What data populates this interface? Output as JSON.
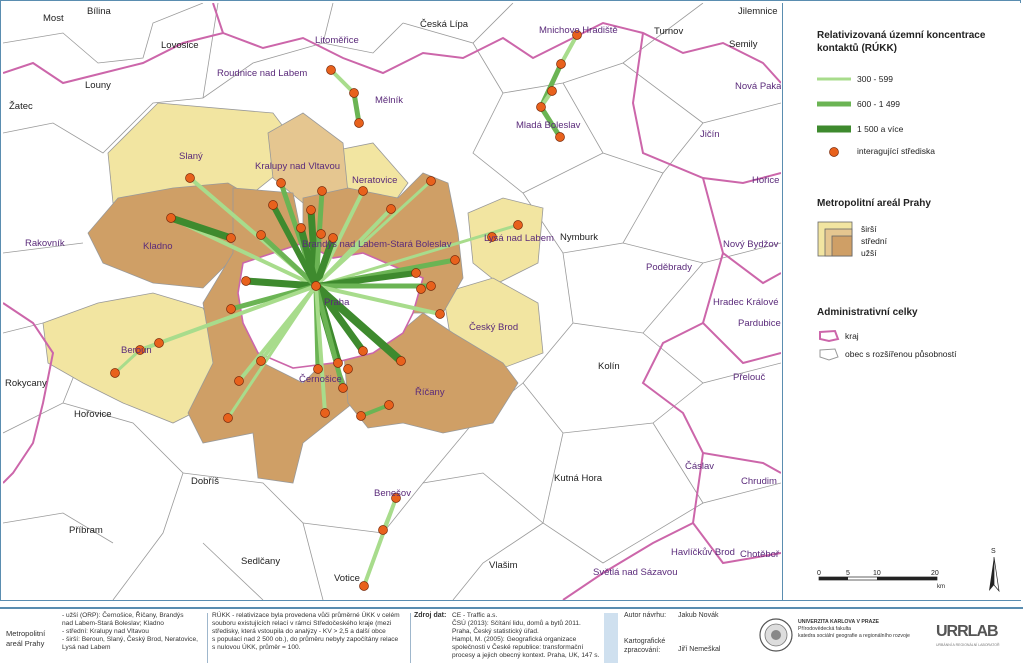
{
  "legend": {
    "title_contacts_1": "Relativizovaná územní koncentrace",
    "title_contacts_2": "kontaktů (RÚKK)",
    "class1": "300 - 599",
    "class2": "600 - 1 499",
    "class3": "1 500 a více",
    "centres": "interagující střediska",
    "title_area": "Metropolitní areál Prahy",
    "wider": "širší",
    "middle": "střední",
    "inner": "užší",
    "title_admin": "Administrativní celky",
    "kraj": "kraj",
    "orp": "obec s rozšířenou působností",
    "scale_ticks": [
      "0",
      "5",
      "10",
      "20"
    ],
    "scale_unit": "km",
    "north": "S"
  },
  "places": {
    "most": "Most",
    "bilina": "Bílina",
    "lovosice": "Lovosice",
    "litomerice": "Litoměřice",
    "ceska_lipa": "Česká Lípa",
    "mnichovo": "Mnichovo Hradiště",
    "turnov": "Turnov",
    "jilemnice": "Jilemnice",
    "semily": "Semily",
    "louny": "Louny",
    "roudnice": "Roudnice nad Labem",
    "melnik": "Mělník",
    "nova_paka": "Nová Paka",
    "zatec": "Žatec",
    "mlada": "Mladá Boleslav",
    "jicin": "Jičín",
    "slany": "Slaný",
    "kralupy": "Kralupy nad Vltavou",
    "neratovice": "Neratovice",
    "horice": "Hořice",
    "rakovnik": "Rakovník",
    "kladno": "Kladno",
    "brandys": "Brandýs nad Labem-Stará Boleslav",
    "lysa": "Lysá nad Labem",
    "nymburk": "Nymburk",
    "novy_bydzov": "Nový Bydžov",
    "podebrady": "Poděbrady",
    "praha": "Praha",
    "hradec": "Hradec Králové",
    "pardubice": "Pardubice",
    "beroun": "Beroun",
    "cesky_brod": "Český Brod",
    "rokycany": "Rokycany",
    "cernosice": "Černošice",
    "kolin": "Kolín",
    "prelouc": "Přelouč",
    "horovice": "Hořovice",
    "ricany": "Říčany",
    "caslav": "Čáslav",
    "chrudim": "Chrudim",
    "dobris": "Dobříš",
    "kutna_hora": "Kutná Hora",
    "benesov": "Benešov",
    "pribram": "Příbram",
    "havlickuv": "Havlíčkův Brod",
    "chotebor": "Chotěboř",
    "sedlcany": "Sedlčany",
    "vlasim": "Vlašim",
    "svetla": "Světlá nad Sázavou",
    "votice": "Votice"
  },
  "footer": {
    "area_label": "Metropolitní areál Prahy",
    "area_desc": [
      "- užší (ORP): Černošice, Říčany, Brandýs",
      "nad Labem-Stará Boleslav; Kladno",
      "- střední: Kralupy nad Vltavou",
      "- širší: Beroun, Slaný, Český Brod, Neratovice,",
      "Lysá nad Labem"
    ],
    "rukk_desc": [
      "RÚKK - relativizace byla provedena vůči průměrné ÚKK v celém",
      "souboru existujících relací v rámci Středočeského kraje (mezi",
      "středisky, která vstoupila do analýzy - KV > 2,5 a další obce",
      "s populací nad 2 500 ob.), do průměru nebyly započítány relace",
      "s nulovou ÚKK, průměr = 100."
    ],
    "source_label": "Zdroj dat:",
    "source_desc": [
      "CE - Traffic a.s.",
      "ČSÚ (2013): Sčítání lidu, domů a bytů 2011.",
      "Praha, Český statistický úřad.",
      "Hampl, M. (2005): Geografická organizace",
      "společnosti v České republice: transformační",
      "procesy a jejich obecný kontext. Praha, UK, 147 s."
    ],
    "author_label": "Autor návrhu:",
    "author": "Jakub Novák",
    "carto_label": "Kartografické zpracování:",
    "carto": "Jiří Nemeškal",
    "univ": [
      "UNIVERZITA KARLOVA V PRAZE",
      "Přírodovědecká fakulta",
      "katedra sociální geografie a regionálního rozvoje"
    ],
    "urrlab": "URRLAB",
    "urrlab_sub": "URBÁNNÍ A REGIONÁLNÍ LABORATOŘ"
  },
  "colors": {
    "wider": "#f2e5a1",
    "middle": "#e5c690",
    "inner": "#cf9f66",
    "line1": "#a8dc8c",
    "line2": "#6bb454",
    "line3": "#3e8a2e",
    "centre": "#e8611c",
    "kraj": "#cc66aa"
  }
}
